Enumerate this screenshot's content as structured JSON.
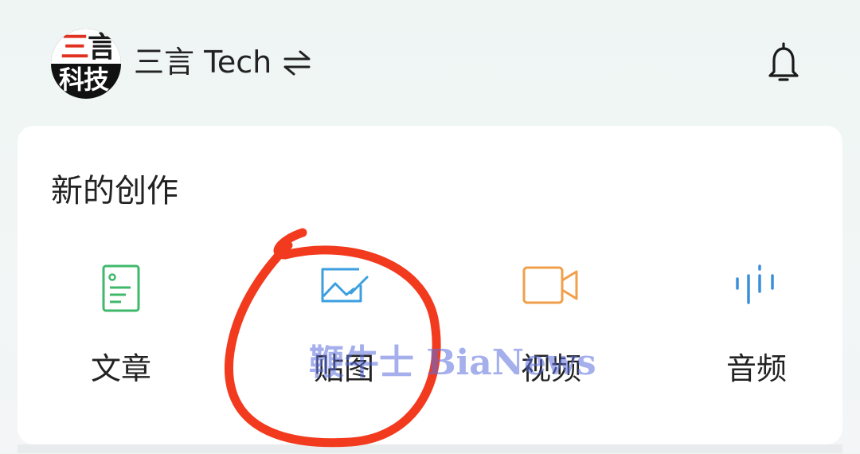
{
  "header": {
    "avatar_text_top": "三言",
    "avatar_text_bottom": "科技",
    "account_name": "三言 Tech",
    "swap_icon": "swap-icon",
    "bell_icon": "bell-icon"
  },
  "card": {
    "title": "新的创作",
    "items": [
      {
        "label": "文章",
        "icon": "document-icon",
        "color": "#3fb86a"
      },
      {
        "label": "贴图",
        "icon": "image-edit-icon",
        "color": "#3b9fe0"
      },
      {
        "label": "视频",
        "icon": "video-camera-icon",
        "color": "#f0a04a"
      },
      {
        "label": "音频",
        "icon": "audio-wave-icon",
        "color": "#3b8fd8"
      }
    ]
  },
  "annotation": {
    "circle_color": "#f23a1e",
    "watermark": "鞭牛士 BiaNews"
  }
}
